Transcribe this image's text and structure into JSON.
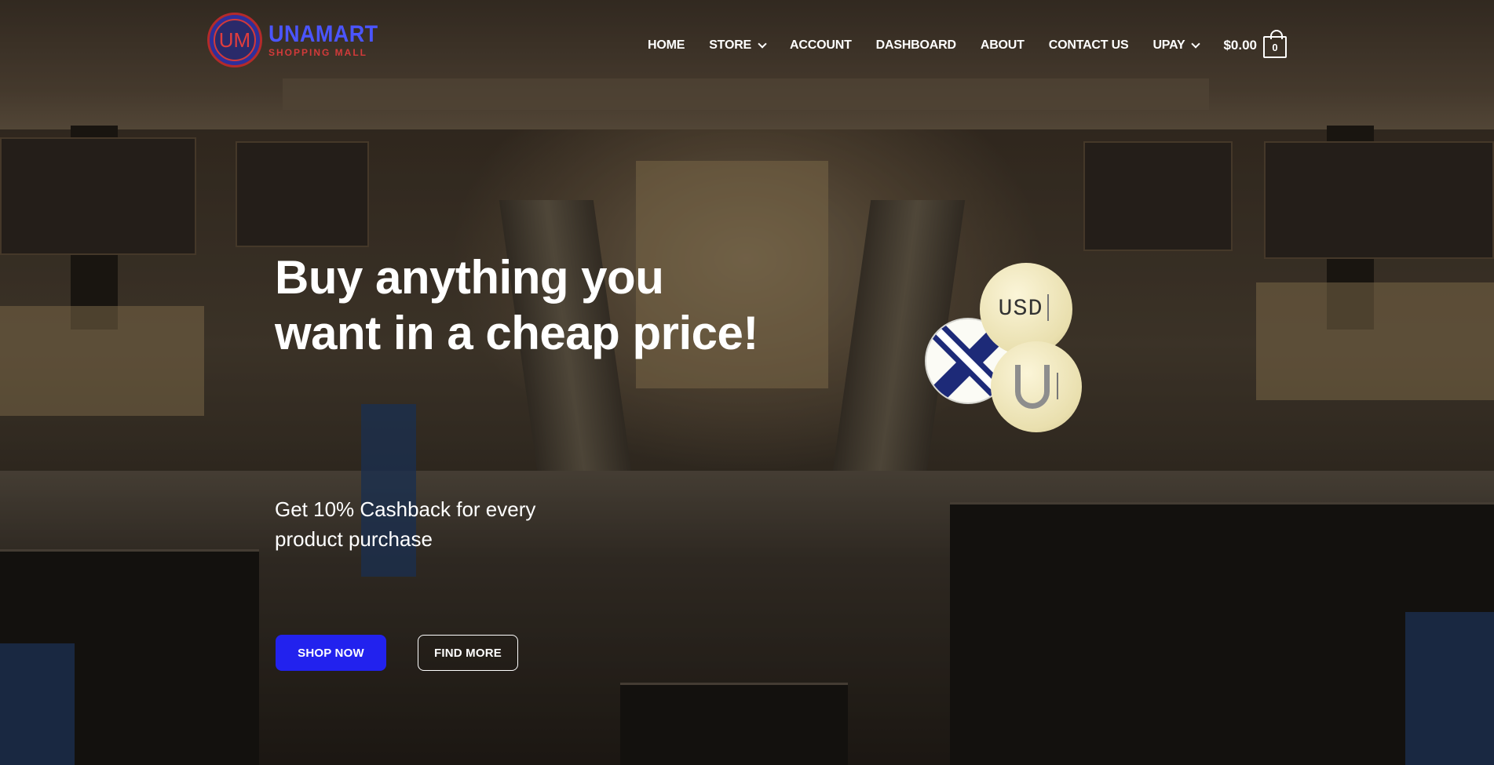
{
  "brand": {
    "name": "UNAMART",
    "tagline": "SHOPPING MALL",
    "logo_letters": "UM"
  },
  "nav": {
    "items": [
      {
        "label": "HOME",
        "has_dropdown": false
      },
      {
        "label": "STORE",
        "has_dropdown": true
      },
      {
        "label": "ACCOUNT",
        "has_dropdown": false
      },
      {
        "label": "DASHBOARD",
        "has_dropdown": false
      },
      {
        "label": "ABOUT",
        "has_dropdown": false
      },
      {
        "label": "CONTACT US",
        "has_dropdown": false
      },
      {
        "label": "UPAY",
        "has_dropdown": true
      }
    ],
    "cart": {
      "total": "$0.00",
      "count": "0"
    }
  },
  "hero": {
    "headline": "Buy anything you want in a cheap price!",
    "subline": "Get 10% Cashback for every product purchase",
    "primary_button": "SHOP NOW",
    "secondary_button": "FIND MORE",
    "coins": {
      "usd_label": "USD"
    }
  },
  "colors": {
    "accent": "#2222ee",
    "brand_blue": "#4b55ff",
    "brand_red": "#d23a3a"
  }
}
